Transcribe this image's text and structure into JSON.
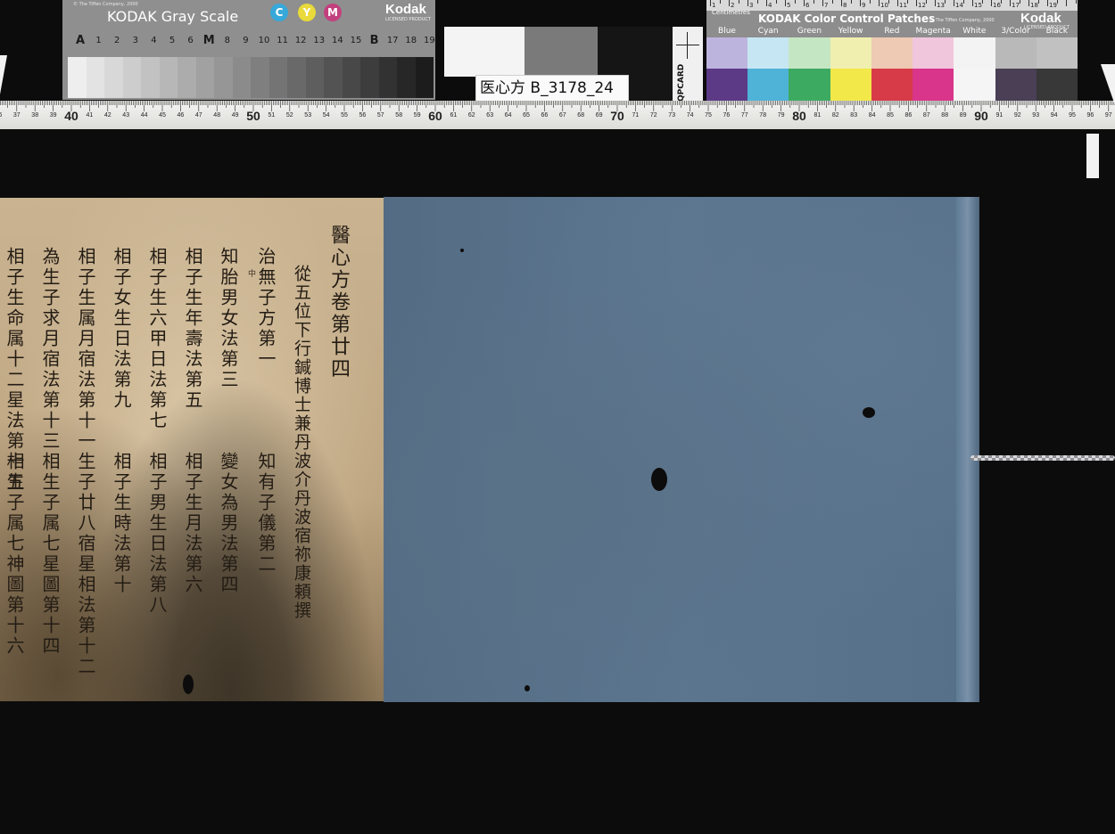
{
  "gray_card": {
    "copyright": "© The Tiffen Company, 2000",
    "title": "KODAK Gray Scale",
    "cym": [
      "C",
      "Y",
      "M"
    ],
    "logo": "Kodak",
    "logo_sub": "LICENSED PRODUCT",
    "scale_labels": [
      "A",
      "1",
      "2",
      "3",
      "4",
      "5",
      "6",
      "M",
      "8",
      "9",
      "10",
      "11",
      "12",
      "13",
      "14",
      "15",
      "B",
      "17",
      "18",
      "19"
    ],
    "colors": {
      "cyan": "#37a8d9",
      "yellow": "#e9d93a",
      "magenta": "#c2407e"
    }
  },
  "color_card": {
    "unit": "Centimetres",
    "title": "KODAK Color Control Patches",
    "copyright": "© The Tiffen Company, 2000",
    "logo": "Kodak",
    "logo_sub": "LICENSED PRODUCT",
    "ruler_numbers": [
      "1",
      "2",
      "3",
      "4",
      "5",
      "6",
      "7",
      "8",
      "9",
      "10",
      "11",
      "12",
      "13",
      "14",
      "15",
      "16",
      "17",
      "18",
      "19"
    ],
    "patch_names": [
      "Blue",
      "Cyan",
      "Green",
      "Yellow",
      "Red",
      "Magenta",
      "White",
      "3/Color",
      "Black"
    ],
    "top_colors": [
      "#bdb4dd",
      "#c6e6f3",
      "#c5e6c3",
      "#f0efb0",
      "#eec9b4",
      "#efc6db",
      "#f3f3f3",
      "#b9b9b9",
      "#c1c1c1"
    ],
    "bottom_colors": [
      "#5c3a86",
      "#4fb2d7",
      "#3daa61",
      "#f3e84a",
      "#d83b48",
      "#d9358b",
      "#f5f5f5",
      "#4a3f55",
      "#383838"
    ]
  },
  "target": {
    "qp_label": "QPCARD",
    "call_number": "医心方 B_3178_24"
  },
  "ruler": {
    "major_labels": [
      "40",
      "50",
      "60",
      "70",
      "80",
      "90"
    ]
  },
  "document": {
    "title_column": "醫心方卷第廿四",
    "author_column": "從五位下行鍼博士兼丹波介丹波宿祢康頼撰",
    "toc_top": [
      "治無子方第一",
      "知胎男女法第三",
      "相子生年壽法第五",
      "相子生六甲日法第七",
      "相子女生日法第九",
      "相子生属月宿法第十一",
      "為生子求月宿法第十三",
      "相子生命属十二星法第十五"
    ],
    "toc_bottom": [
      "知有子儀第二",
      "變女為男法第四",
      "相子生月法第六",
      "相子男生日法第八",
      "相子生時法第十",
      "生子廿八宿星相法第十二",
      "相生子属七星圖第十四",
      "相生子属七神圖第十六"
    ],
    "annotation": "中"
  },
  "colors": {
    "background": "#0d0c0c",
    "paper": "#c5ad89",
    "cover": "#58728c",
    "ink": "#231c14"
  }
}
